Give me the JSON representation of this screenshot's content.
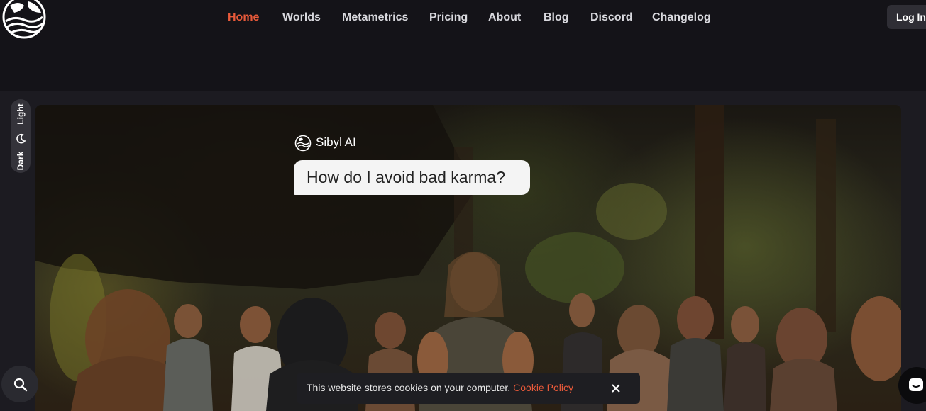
{
  "nav": {
    "items": [
      {
        "label": "Home",
        "active": true
      },
      {
        "label": "Worlds",
        "active": false
      },
      {
        "label": "Metametrics",
        "active": false
      },
      {
        "label": "Pricing",
        "active": false
      },
      {
        "label": "About",
        "active": false
      },
      {
        "label": "Blog",
        "active": false
      },
      {
        "label": "Discord",
        "active": false
      },
      {
        "label": "Changelog",
        "active": false
      }
    ],
    "login_label": "Log In"
  },
  "theme_toggle": {
    "dark_label": "Dark",
    "light_label": "Light",
    "icon": "moon-icon"
  },
  "hero": {
    "assistant_name": "Sibyl AI",
    "question": "How do I avoid bad karma?"
  },
  "cookie_banner": {
    "message": "This website stores cookies on your computer.",
    "link_label": "Cookie Policy",
    "close_icon": "close-icon"
  },
  "floating": {
    "search_icon": "search-icon",
    "chat_icon": "chat-icon"
  },
  "colors": {
    "accent": "#ea5a3a",
    "page_bg": "#1c1b21",
    "topbar_bg": "#141318"
  }
}
